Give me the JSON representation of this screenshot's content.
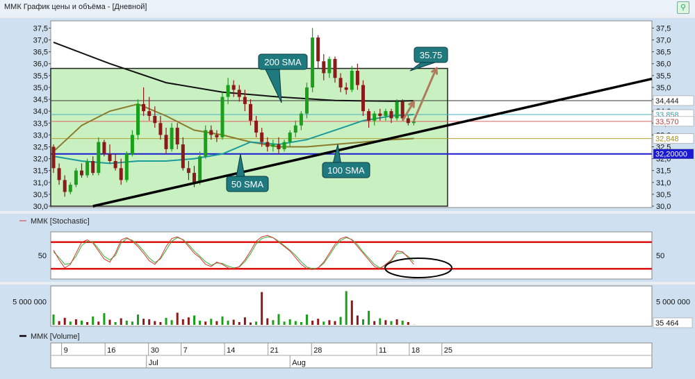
{
  "window": {
    "title": "ММК График цены и объёма - [Дневной]",
    "pin_icon": "pin-icon"
  },
  "colors": {
    "up": "#1aa01a",
    "down": "#8b1a1a",
    "sma200": "#111111",
    "sma100": "#8a7a2a",
    "sma50": "#1a9a9a",
    "zone": "#c8f0c0",
    "callout": "#1f7a80",
    "arrow": "#b07a5a",
    "stoch_k": "#e03030",
    "stoch_d": "#2fb52f"
  },
  "chart_data": [
    {
      "type": "candlestick",
      "ylim": [
        30.0,
        37.6
      ],
      "yticks": [
        "37,5",
        "37,0",
        "36,5",
        "36,0",
        "35,5",
        "35,0",
        "34,5",
        "34,0",
        "33,5",
        "33,0",
        "32,5",
        "32,0",
        "31,5",
        "31,0",
        "30,5",
        "30,0"
      ],
      "right_yticks": [
        "37,5",
        "37,0",
        "36,5",
        "36,0",
        "35,5",
        "35,0",
        "34,5",
        "34,0",
        "33,5",
        "33,0",
        "32,5",
        "32,0",
        "31,5",
        "31,0",
        "30,5",
        "30,0"
      ],
      "candles": [
        [
          32.5,
          32.6,
          31.4,
          31.6
        ],
        [
          31.6,
          31.8,
          30.9,
          31.1
        ],
        [
          31.1,
          31.3,
          30.4,
          30.6
        ],
        [
          30.6,
          31.0,
          30.5,
          30.9
        ],
        [
          30.9,
          31.6,
          30.8,
          31.5
        ],
        [
          31.5,
          31.8,
          31.2,
          31.3
        ],
        [
          31.3,
          32.0,
          31.2,
          31.9
        ],
        [
          31.9,
          32.1,
          31.3,
          31.4
        ],
        [
          31.4,
          32.9,
          31.3,
          32.7
        ],
        [
          32.7,
          32.8,
          32.1,
          32.2
        ],
        [
          32.2,
          32.6,
          31.8,
          31.9
        ],
        [
          31.9,
          32.2,
          31.5,
          31.6
        ],
        [
          31.6,
          32.0,
          30.9,
          31.1
        ],
        [
          31.1,
          32.3,
          31.0,
          32.2
        ],
        [
          32.2,
          33.2,
          32.1,
          33.0
        ],
        [
          33.0,
          34.5,
          32.8,
          34.3
        ],
        [
          34.3,
          35.0,
          33.8,
          34.0
        ],
        [
          34.0,
          34.6,
          33.6,
          33.8
        ],
        [
          33.8,
          34.2,
          33.3,
          33.5
        ],
        [
          33.5,
          33.8,
          32.8,
          33.0
        ],
        [
          33.0,
          33.3,
          32.2,
          32.4
        ],
        [
          32.4,
          33.5,
          32.3,
          33.3
        ],
        [
          33.3,
          33.5,
          32.4,
          32.6
        ],
        [
          32.6,
          32.9,
          31.5,
          31.6
        ],
        [
          31.6,
          31.9,
          31.1,
          31.4
        ],
        [
          31.4,
          31.7,
          30.8,
          31.0
        ],
        [
          31.0,
          32.3,
          30.9,
          32.1
        ],
        [
          32.1,
          33.4,
          32.0,
          33.2
        ],
        [
          33.2,
          33.4,
          32.8,
          33.0
        ],
        [
          33.0,
          33.2,
          32.7,
          32.9
        ],
        [
          32.9,
          34.8,
          32.8,
          34.6
        ],
        [
          34.6,
          35.4,
          34.3,
          35.1
        ],
        [
          35.1,
          35.3,
          34.6,
          34.9
        ],
        [
          34.9,
          35.1,
          34.4,
          34.6
        ],
        [
          34.6,
          34.9,
          34.0,
          34.3
        ],
        [
          34.3,
          34.5,
          33.4,
          33.6
        ],
        [
          33.6,
          33.8,
          32.9,
          33.1
        ],
        [
          33.1,
          33.3,
          32.5,
          32.7
        ],
        [
          32.7,
          32.9,
          32.3,
          32.5
        ],
        [
          32.5,
          32.8,
          32.3,
          32.6
        ],
        [
          32.6,
          32.9,
          32.2,
          32.4
        ],
        [
          32.4,
          32.8,
          32.3,
          32.7
        ],
        [
          32.7,
          33.2,
          32.5,
          33.1
        ],
        [
          33.1,
          33.6,
          32.9,
          33.4
        ],
        [
          33.4,
          34.0,
          33.2,
          33.9
        ],
        [
          33.9,
          35.2,
          33.7,
          35.0
        ],
        [
          35.0,
          37.5,
          34.8,
          37.1
        ],
        [
          37.1,
          37.2,
          35.8,
          36.1
        ],
        [
          36.1,
          36.4,
          35.3,
          35.6
        ],
        [
          35.6,
          36.3,
          35.4,
          36.2
        ],
        [
          36.2,
          36.3,
          35.2,
          35.4
        ],
        [
          35.4,
          35.6,
          34.8,
          35.0
        ],
        [
          35.0,
          35.2,
          34.7,
          34.9
        ],
        [
          34.9,
          35.9,
          34.8,
          35.7
        ],
        [
          35.7,
          36.0,
          34.9,
          35.1
        ],
        [
          35.1,
          35.3,
          33.8,
          34.0
        ],
        [
          34.0,
          34.1,
          33.3,
          33.6
        ],
        [
          33.6,
          34.0,
          33.4,
          33.9
        ],
        [
          33.9,
          34.1,
          33.6,
          33.8
        ],
        [
          33.8,
          34.1,
          33.6,
          34.0
        ],
        [
          34.0,
          34.1,
          33.5,
          33.7
        ],
        [
          33.7,
          34.5,
          33.6,
          34.4
        ],
        [
          34.4,
          34.5,
          33.6,
          33.7
        ],
        [
          33.7,
          33.8,
          33.4,
          33.5
        ],
        [
          33.5,
          33.6,
          33.4,
          33.56
        ]
      ],
      "sma200": [
        [
          0,
          36.9
        ],
        [
          10,
          36.0
        ],
        [
          20,
          35.2
        ],
        [
          30,
          34.8
        ],
        [
          40,
          34.6
        ],
        [
          50,
          34.45
        ],
        [
          60,
          34.42
        ],
        [
          64,
          34.44
        ]
      ],
      "sma100": [
        [
          0,
          32.3
        ],
        [
          5,
          33.4
        ],
        [
          10,
          34.0
        ],
        [
          15,
          34.3
        ],
        [
          20,
          33.8
        ],
        [
          25,
          33.2
        ],
        [
          30,
          33.0
        ],
        [
          35,
          32.7
        ],
        [
          40,
          32.5
        ],
        [
          45,
          32.5
        ],
        [
          50,
          32.6
        ],
        [
          55,
          32.7
        ],
        [
          60,
          32.8
        ],
        [
          64,
          32.85
        ]
      ],
      "sma50": [
        [
          0,
          32.1
        ],
        [
          5,
          31.9
        ],
        [
          10,
          31.8
        ],
        [
          15,
          31.9
        ],
        [
          20,
          31.9
        ],
        [
          25,
          32.0
        ],
        [
          30,
          32.2
        ],
        [
          35,
          32.7
        ],
        [
          40,
          32.6
        ],
        [
          45,
          32.8
        ],
        [
          50,
          33.2
        ],
        [
          55,
          33.6
        ],
        [
          60,
          33.8
        ],
        [
          64,
          33.86
        ]
      ],
      "hlines": [
        34.444,
        33.858,
        33.57,
        32.848,
        32.2
      ],
      "price_labels": [
        "34,444",
        "33,858",
        "33,570",
        "32,848",
        "32,20000"
      ],
      "zone": {
        "y_top": 35.8,
        "y_bottom": 30.0,
        "x_start": 0,
        "x_end": 70
      },
      "trendline": [
        [
          7,
          30.0
        ],
        [
          107,
          35.4
        ]
      ],
      "forecast_arrows": [
        [
          [
            64,
            33.6
          ],
          [
            68,
            35.8
          ]
        ],
        [
          [
            62,
            33.6
          ],
          [
            64,
            34.4
          ]
        ]
      ],
      "annotations": [
        "200 SMA",
        "35.75",
        "50 SMA",
        "100 SMA"
      ]
    },
    {
      "type": "line",
      "title": "ММК [Stochastic]",
      "yticks": [
        "50"
      ],
      "right_yticks": [
        "50"
      ],
      "upper_level": 80,
      "lower_level": 20,
      "k": [
        62,
        40,
        22,
        30,
        55,
        80,
        85,
        78,
        60,
        42,
        35,
        55,
        85,
        90,
        82,
        70,
        55,
        38,
        30,
        45,
        70,
        88,
        92,
        85,
        70,
        55,
        45,
        30,
        25,
        35,
        30,
        22,
        20,
        25,
        40,
        60,
        82,
        92,
        95,
        90,
        80,
        70,
        60,
        45,
        30,
        20,
        18,
        22,
        35,
        55,
        75,
        88,
        92,
        85,
        70,
        55,
        40,
        25,
        20,
        30,
        40,
        60,
        58,
        45,
        30
      ],
      "d": [
        58,
        45,
        30,
        32,
        48,
        72,
        82,
        80,
        65,
        48,
        40,
        50,
        78,
        88,
        84,
        74,
        60,
        44,
        34,
        42,
        62,
        82,
        90,
        86,
        74,
        60,
        48,
        36,
        28,
        33,
        32,
        26,
        22,
        24,
        36,
        54,
        76,
        88,
        92,
        90,
        82,
        72,
        62,
        50,
        36,
        24,
        20,
        22,
        32,
        50,
        70,
        84,
        90,
        86,
        74,
        58,
        44,
        30,
        22,
        28,
        38,
        54,
        56,
        48,
        36
      ]
    },
    {
      "type": "bar",
      "title": "ММК [Volume]",
      "yticks": [
        "5 000 000"
      ],
      "right_yticks": [
        "5 000 000",
        "35 464"
      ],
      "ylim": [
        0,
        8000000
      ],
      "values": [
        2200000,
        800000,
        1500000,
        700000,
        1200000,
        900000,
        600000,
        1800000,
        700000,
        2500000,
        1100000,
        600000,
        1400000,
        900000,
        700000,
        2200000,
        1300000,
        1200000,
        800000,
        600000,
        1500000,
        1000000,
        2600000,
        1200000,
        1600000,
        2000000,
        900000,
        700000,
        1300000,
        800000,
        1800000,
        900000,
        1100000,
        600000,
        1600000,
        500000,
        700000,
        7000000,
        1400000,
        1000000,
        2300000,
        700000,
        1200000,
        800000,
        600000,
        2200000,
        900000,
        1300000,
        700000,
        1000000,
        800000,
        1700000,
        7200000,
        5200000,
        2000000,
        1200000,
        3000000,
        800000,
        1400000,
        1000000,
        800000,
        1200000,
        900000,
        600000,
        35464
      ],
      "up": [
        true,
        false,
        false,
        true,
        false,
        true,
        false,
        true,
        false,
        true,
        false,
        true,
        false,
        true,
        true,
        true,
        false,
        false,
        false,
        false,
        true,
        true,
        false,
        false,
        false,
        true,
        true,
        false,
        true,
        false,
        true,
        true,
        false,
        false,
        false,
        false,
        true,
        false,
        false,
        true,
        true,
        true,
        true,
        true,
        true,
        true,
        false,
        false,
        true,
        false,
        false,
        true,
        true,
        false,
        false,
        true,
        true,
        false,
        true,
        false,
        true,
        false,
        true,
        false,
        true
      ]
    }
  ],
  "xaxis": {
    "day_labels": [
      "9",
      "16",
      "30",
      "7",
      "14",
      "21",
      "28",
      "11",
      "18",
      "25"
    ],
    "day_index": [
      1,
      5,
      9,
      12,
      16,
      20,
      24,
      30,
      33,
      36
    ],
    "month_labels": [
      "Jul",
      "Aug"
    ],
    "month_index": [
      10,
      25
    ]
  }
}
